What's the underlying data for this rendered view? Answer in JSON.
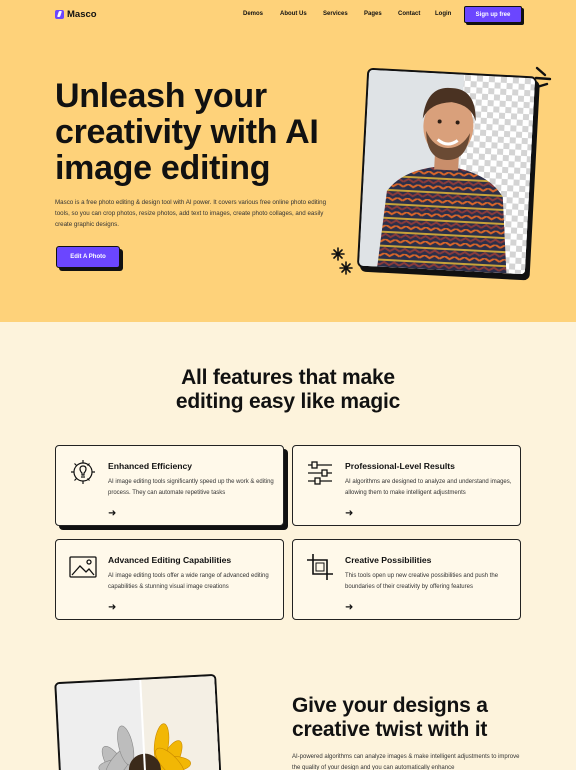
{
  "brand": {
    "name": "Masco",
    "accent": "#6b46ff",
    "hero_bg": "#fed27a",
    "page_bg": "#fdf3dc"
  },
  "nav": {
    "items": [
      "Demos",
      "About Us",
      "Services",
      "Pages",
      "Contact",
      "Login"
    ],
    "signup_label": "Sign up free"
  },
  "hero": {
    "title_lines": [
      "Unleash your",
      "creativity with AI",
      "image editing"
    ],
    "description": "Masco is a free photo editing & design tool with AI power. It covers various free online photo editing tools, so you can crop photos, resize photos, add text to images, create photo collages, and easily create graphic designs.",
    "cta_label": "Edit A Photo"
  },
  "features": {
    "title_lines": [
      "All features that make",
      "editing easy like magic"
    ],
    "cards": [
      {
        "icon": "lightbulb-gear-icon",
        "title": "Enhanced Efficiency",
        "text": "AI image editing tools significantly speed up the work & editing process. They can automate repetitive tasks"
      },
      {
        "icon": "sliders-icon",
        "title": "Professional-Level Results",
        "text": "AI algorithms are designed to analyze and understand images, allowing them to make intelligent adjustments"
      },
      {
        "icon": "image-icon",
        "title": "Advanced Editing Capabilities",
        "text": "AI image editing tools offer a wide range of advanced editing capabilities & stunning visual image creations"
      },
      {
        "icon": "crop-icon",
        "title": "Creative Possibilities",
        "text": "This tools open up new creative possibilities and push the boundaries of their creativity by offering features"
      }
    ]
  },
  "twist": {
    "title_lines": [
      "Give your designs a",
      "creative twist with it"
    ],
    "description": "AI-powered algorithms can analyze images & make intelligent adjustments to improve the quality of your design and you can automatically enhance"
  }
}
